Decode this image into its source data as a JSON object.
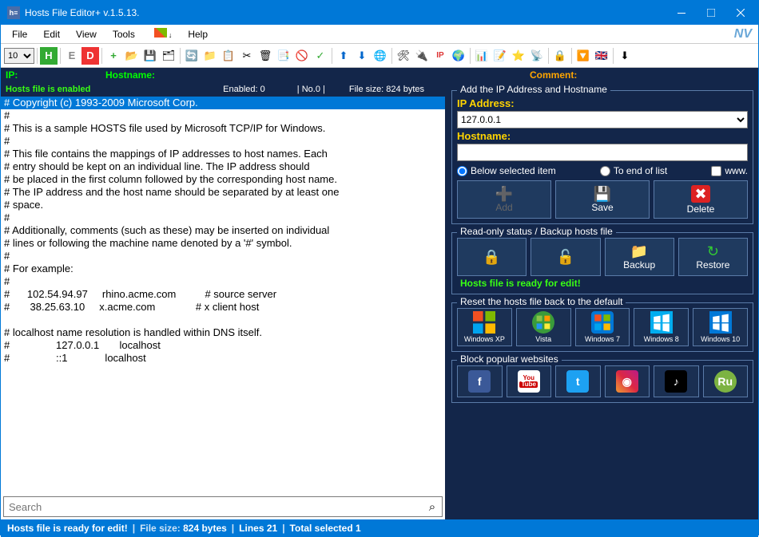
{
  "titlebar": {
    "title": "Hosts File Editor+ v.1.5.13."
  },
  "menu": {
    "file": "File",
    "edit": "Edit",
    "view": "View",
    "tools": "Tools",
    "help": "Help"
  },
  "toolbar": {
    "fontsize": "10"
  },
  "header": {
    "ip": "IP:",
    "hostname": "Hostname:",
    "comment": "Comment:"
  },
  "status": {
    "enabled": "Hosts file is enabled",
    "enabled_count": "Enabled: 0",
    "no": "| No.0 |",
    "filesize": "File size: 824 bytes"
  },
  "editor_lines": [
    "# Copyright (c) 1993-2009 Microsoft Corp.",
    "#",
    "# This is a sample HOSTS file used by Microsoft TCP/IP for Windows.",
    "#",
    "# This file contains the mappings of IP addresses to host names. Each",
    "# entry should be kept on an individual line. The IP address should",
    "# be placed in the first column followed by the corresponding host name.",
    "# The IP address and the host name should be separated by at least one",
    "# space.",
    "#",
    "# Additionally, comments (such as these) may be inserted on individual",
    "# lines or following the machine name denoted by a '#' symbol.",
    "#",
    "# For example:",
    "#",
    "#      102.54.94.97     rhino.acme.com          # source server",
    "#       38.25.63.10     x.acme.com              # x client host",
    "",
    "# localhost name resolution is handled within DNS itself.",
    "#                127.0.0.1       localhost",
    "#                ::1             localhost"
  ],
  "search": {
    "placeholder": "Search"
  },
  "right": {
    "add_title": "Add the IP Address  and Hostname",
    "ip_label": "IP Address:",
    "ip_value": "127.0.0.1",
    "hostname_label": "Hostname:",
    "hostname_value": "",
    "opt_below": "Below selected item",
    "opt_end": "To end of list",
    "opt_www": "www.",
    "btn_add": "Add",
    "btn_save": "Save",
    "btn_delete": "Delete",
    "ro_title": "Read-only status / Backup hosts file",
    "btn_backup": "Backup",
    "btn_restore": "Restore",
    "ready": "Hosts file is ready for edit!",
    "reset_title": "Reset the hosts file back to the default",
    "os": [
      "Windows XP",
      "Vista",
      "Windows 7",
      "Windows 8",
      "Windows 10"
    ],
    "block_title": "Block popular websites"
  },
  "footer": {
    "ready": "Hosts file is ready for edit!",
    "fs_label": "File size:",
    "fs_val": "824 bytes",
    "lines": "Lines 21",
    "sel": "Total selected 1"
  }
}
